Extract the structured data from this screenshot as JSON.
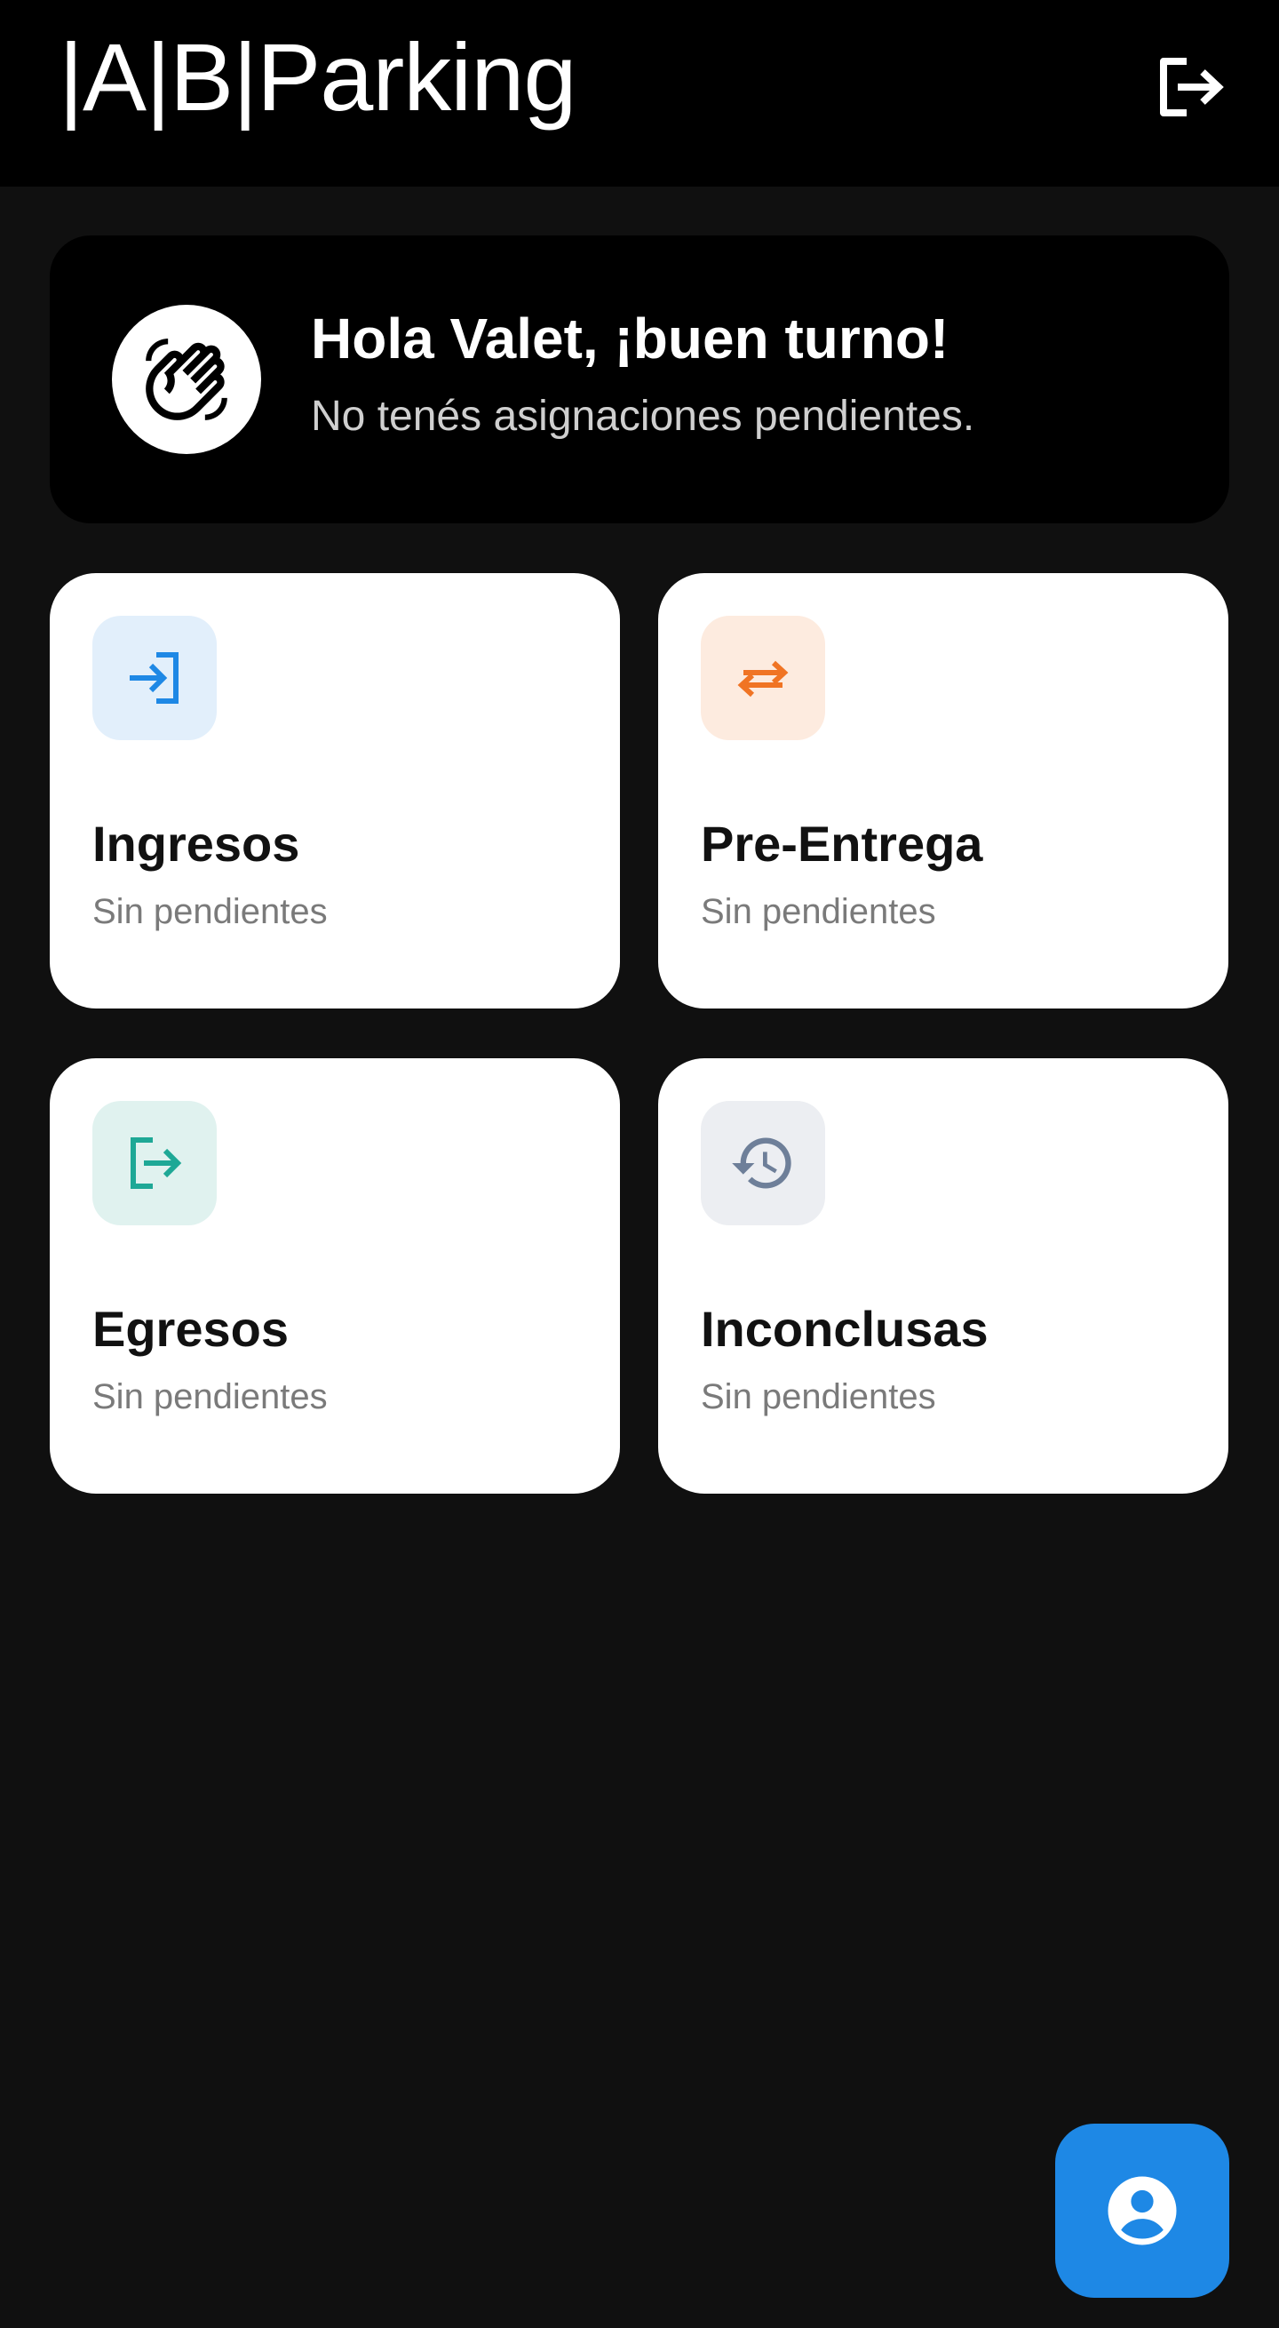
{
  "header": {
    "logo_text": "|A|B|Parking",
    "logout_icon": "logout-icon"
  },
  "greeting": {
    "icon": "waving-hand-icon",
    "title": "Hola Valet, ¡buen turno!",
    "subtitle": "No tenés asignaciones pendientes."
  },
  "tiles": [
    {
      "title": "Ingresos",
      "subtitle": "Sin pendientes",
      "icon": "login-icon",
      "icon_color": "#1e88e5",
      "icon_bg": "#e2effb"
    },
    {
      "title": "Pre-Entrega",
      "subtitle": "Sin pendientes",
      "icon": "swap-horiz-icon",
      "icon_color": "#f07424",
      "icon_bg": "#fdebdf"
    },
    {
      "title": "Egresos",
      "subtitle": "Sin pendientes",
      "icon": "logout-icon",
      "icon_color": "#1ea896",
      "icon_bg": "#e0f2ef"
    },
    {
      "title": "Inconclusas",
      "subtitle": "Sin pendientes",
      "icon": "history-icon",
      "icon_color": "#6e7f99",
      "icon_bg": "#eceef2"
    }
  ],
  "fab": {
    "icon": "account-circle-icon",
    "color": "#1e88e5"
  }
}
